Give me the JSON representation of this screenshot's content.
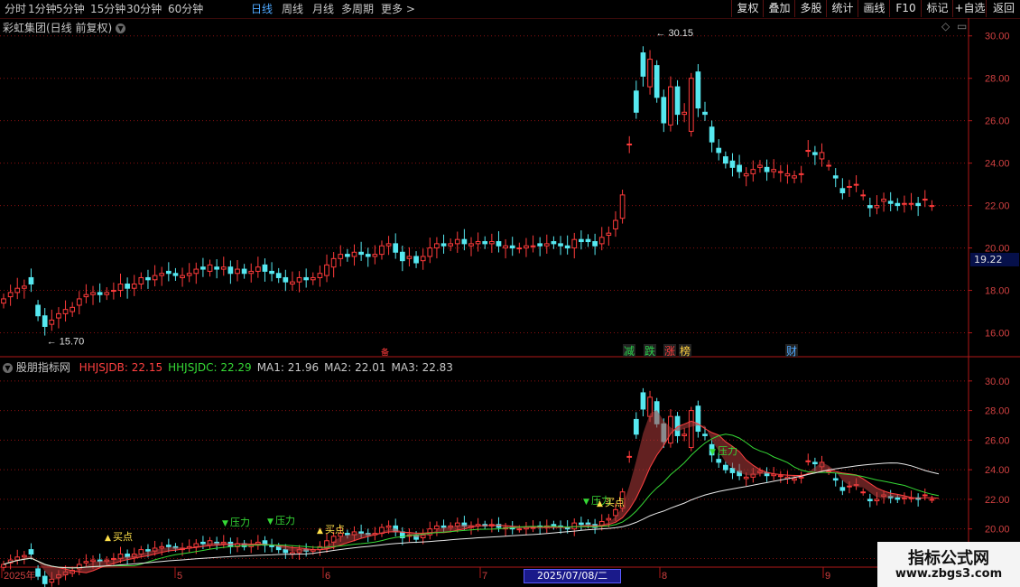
{
  "toolbar": {
    "periods": [
      "分时",
      "1分钟",
      "5分钟",
      "15分钟",
      "30分钟",
      "60分钟",
      "日线",
      "周线",
      "月线",
      "多周期",
      "更多 >"
    ],
    "active_period": "日线",
    "buttons": [
      "复权",
      "叠加",
      "多股",
      "统计",
      "画线",
      "F10",
      "标记",
      "+自选",
      "返回"
    ]
  },
  "main_panel": {
    "title": "彩虹集团(日线 前复权)",
    "y_ticks": [
      "30.00",
      "28.00",
      "26.00",
      "24.00",
      "22.00",
      "20.00",
      "18.00",
      "16.00"
    ],
    "current_price_tag": "19.22",
    "high_label": "30.15",
    "low_label": "15.70",
    "event_markers": [
      {
        "text": "减",
        "color": "#2ad14a"
      },
      {
        "text": "跌",
        "color": "#2ad14a"
      },
      {
        "text": "涨",
        "color": "#ff3b3b"
      },
      {
        "text": "榜",
        "color": "#ffcf40"
      },
      {
        "text": "财",
        "color": "#4ea8ff"
      }
    ],
    "small_marker": "备"
  },
  "indicator_panel": {
    "title": "股朋指标网",
    "legend": [
      {
        "label": "HHJSJDB: 22.15",
        "color": "#ff4040"
      },
      {
        "label": "HHJSJDC: 22.29",
        "color": "#35d835"
      },
      {
        "label": "MA1: 21.96",
        "color": "#c8c8c8"
      },
      {
        "label": "MA2: 22.01",
        "color": "#c8c8c8"
      },
      {
        "label": "MA3: 22.83",
        "color": "#c8c8c8"
      }
    ],
    "y_ticks": [
      "30.00",
      "28.00",
      "26.00",
      "24.00",
      "22.00",
      "20.00",
      "18.00"
    ],
    "signals": [
      {
        "text": "买点",
        "color": "#ffe14a"
      },
      {
        "text": "压力",
        "color": "#35d835"
      },
      {
        "text": "压力",
        "color": "#35d835"
      },
      {
        "text": "买点",
        "color": "#ffe14a"
      },
      {
        "text": "压力",
        "color": "#35d835"
      },
      {
        "text": "买点",
        "color": "#ffe14a"
      },
      {
        "text": "压力",
        "color": "#35d835"
      }
    ]
  },
  "x_axis": {
    "labels": [
      "2025年",
      "5",
      "6",
      "7",
      "8",
      "9"
    ],
    "cursor_date": "2025/07/08/二"
  },
  "watermark": {
    "line1": "指标公式网",
    "line2": "www.zbgs3.com"
  },
  "colors": {
    "up": "#ff3b3b",
    "down": "#56e8f0",
    "grid": "#8a1010",
    "axis": "#b01818",
    "ma_red": "#ff4040",
    "ma_green": "#35d835",
    "ma_white": "#e8e8e8"
  },
  "chart_data": {
    "type": "candlestick",
    "ylim_main": [
      15.0,
      30.5
    ],
    "ylim_indicator": [
      17.6,
      30.6
    ],
    "closes": [
      17.6,
      17.9,
      18.1,
      18.2,
      18.3,
      16.8,
      16.3,
      16.6,
      16.9,
      17.1,
      17.2,
      17.6,
      17.8,
      17.9,
      17.8,
      17.9,
      18.0,
      18.3,
      18.1,
      18.3,
      18.6,
      18.5,
      18.7,
      18.8,
      18.8,
      18.7,
      18.7,
      18.8,
      19.0,
      19.0,
      19.2,
      19.0,
      19.1,
      18.8,
      19.0,
      18.8,
      18.9,
      19.1,
      18.9,
      18.8,
      18.6,
      18.4,
      18.4,
      18.6,
      18.5,
      18.6,
      18.8,
      19.2,
      19.5,
      19.7,
      19.6,
      19.8,
      19.7,
      19.6,
      19.7,
      20.1,
      20.2,
      19.8,
      19.4,
      19.6,
      19.3,
      19.6,
      20.0,
      20.2,
      20.1,
      20.2,
      20.4,
      20.2,
      20.2,
      20.3,
      20.2,
      20.3,
      20.1,
      20.1,
      20.0,
      20.0,
      20.1,
      20.1,
      20.1,
      20.2,
      20.2,
      20.1,
      20.0,
      20.4,
      20.3,
      20.3,
      20.1,
      20.5,
      20.7,
      21.3,
      22.5,
      24.9,
      26.4,
      28.1,
      28.9,
      27.1,
      25.9,
      27.6,
      26.3,
      26.4,
      28.0,
      26.6,
      26.3,
      25.0,
      24.5,
      24.0,
      23.8,
      23.6,
      23.5,
      23.7,
      23.9,
      23.6,
      23.7,
      23.6,
      23.5,
      23.4,
      23.5,
      24.6,
      24.4,
      24.5,
      23.9,
      23.3,
      22.6,
      22.9,
      23.0,
      22.5,
      21.9,
      22.0,
      22.3,
      22.1,
      22.0,
      22.1,
      22.1,
      22.0,
      22.3,
      22.0,
      21.9
    ],
    "opens": [
      17.4,
      17.7,
      17.9,
      18.1,
      18.6,
      17.3,
      16.8,
      16.4,
      16.7,
      16.9,
      17.0,
      17.3,
      17.7,
      17.8,
      17.9,
      17.8,
      18.0,
      18.0,
      18.3,
      18.1,
      18.3,
      18.6,
      18.5,
      18.7,
      18.9,
      18.8,
      18.6,
      18.7,
      18.8,
      19.1,
      18.9,
      19.1,
      19.0,
      19.1,
      18.8,
      19.0,
      18.8,
      18.9,
      19.2,
      18.9,
      18.8,
      18.6,
      18.3,
      18.4,
      18.6,
      18.5,
      18.6,
      18.7,
      19.1,
      19.5,
      19.7,
      19.6,
      19.8,
      19.7,
      19.6,
      19.7,
      20.1,
      20.2,
      19.8,
      19.5,
      19.6,
      19.4,
      19.6,
      20.0,
      20.2,
      20.1,
      20.2,
      20.4,
      20.1,
      20.2,
      20.3,
      20.2,
      20.3,
      20.0,
      20.1,
      20.0,
      20.0,
      20.1,
      20.2,
      20.1,
      20.3,
      20.2,
      20.1,
      20.0,
      20.4,
      20.4,
      20.3,
      20.2,
      20.6,
      20.9,
      21.4,
      24.9,
      27.4,
      29.2,
      27.6,
      28.6,
      27.1,
      25.8,
      27.6,
      26.3,
      25.5,
      28.3,
      26.4,
      25.7,
      24.7,
      24.3,
      24.1,
      23.9,
      23.4,
      23.5,
      23.8,
      23.8,
      23.6,
      23.6,
      23.4,
      23.3,
      23.5,
      24.6,
      24.5,
      24.2,
      23.9,
      23.4,
      22.8,
      22.9,
      23.0,
      22.5,
      22.0,
      21.9,
      22.2,
      22.2,
      22.1,
      22.1,
      22.1,
      22.1,
      22.3,
      22.0
    ]
  }
}
